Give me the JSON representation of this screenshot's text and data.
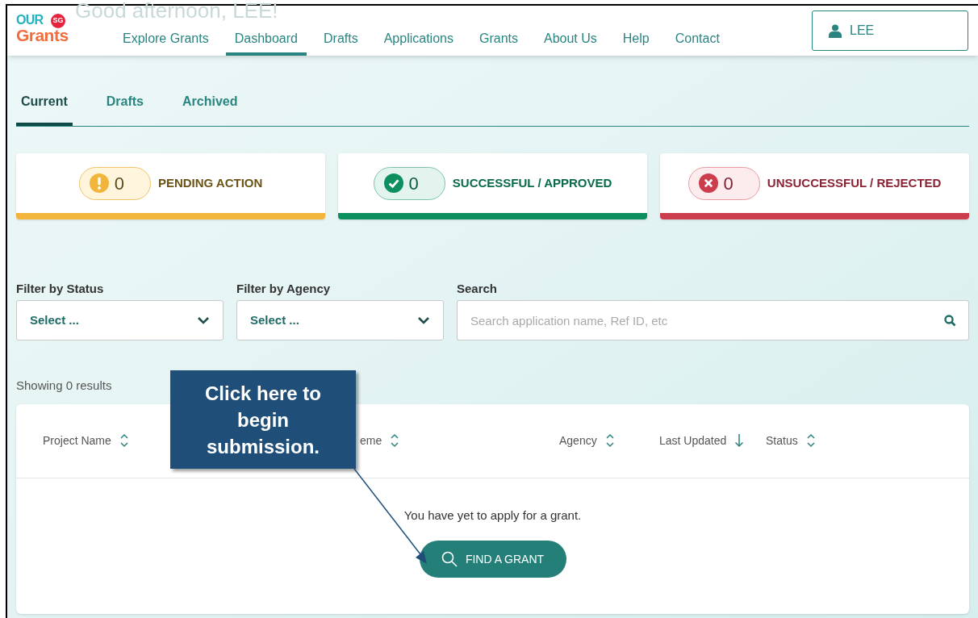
{
  "greeting": "Good afternoon, LEE!",
  "logo": {
    "top": "OUR",
    "badge": "SG",
    "bottom": "Grants"
  },
  "nav": {
    "items": [
      {
        "label": "Explore Grants",
        "selected": false
      },
      {
        "label": "Dashboard",
        "selected": true
      },
      {
        "label": "Drafts",
        "selected": false
      },
      {
        "label": "Applications",
        "selected": false
      },
      {
        "label": "Grants",
        "selected": false
      },
      {
        "label": "About Us",
        "selected": false
      },
      {
        "label": "Help",
        "selected": false
      },
      {
        "label": "Contact",
        "selected": false
      }
    ],
    "user": "LEE"
  },
  "tabs": [
    {
      "label": "Current",
      "selected": true
    },
    {
      "label": "Drafts",
      "selected": false
    },
    {
      "label": "Archived",
      "selected": false
    }
  ],
  "summary": [
    {
      "kind": "pending",
      "count": "0",
      "label": "PENDING ACTION",
      "color": "#f1b53c"
    },
    {
      "kind": "approved",
      "count": "0",
      "label": "SUCCESSFUL / APPROVED",
      "color": "#0d8f5f"
    },
    {
      "kind": "rejected",
      "count": "0",
      "label": "UNSUCCESSFUL / REJECTED",
      "color": "#cc3d4d"
    }
  ],
  "filters": [
    {
      "label": "Filter by Status",
      "value": "Select ..."
    },
    {
      "label": "Filter by Agency",
      "value": "Select ..."
    }
  ],
  "search": {
    "label": "Search",
    "placeholder": "Search application name, Ref ID, etc"
  },
  "results": "Showing 0 results",
  "table": {
    "columns": [
      {
        "label": "Project Name",
        "kind": "sortable"
      },
      {
        "label": "eme",
        "kind": "sortable"
      },
      {
        "label": "Agency",
        "kind": "sortable"
      },
      {
        "label": "Last Updated",
        "kind": "sorted"
      },
      {
        "label": "Status",
        "kind": "sortable"
      }
    ],
    "empty": "You have yet to apply for a grant.",
    "action": "FIND A GRANT"
  },
  "callout": "Click here to begin submission."
}
